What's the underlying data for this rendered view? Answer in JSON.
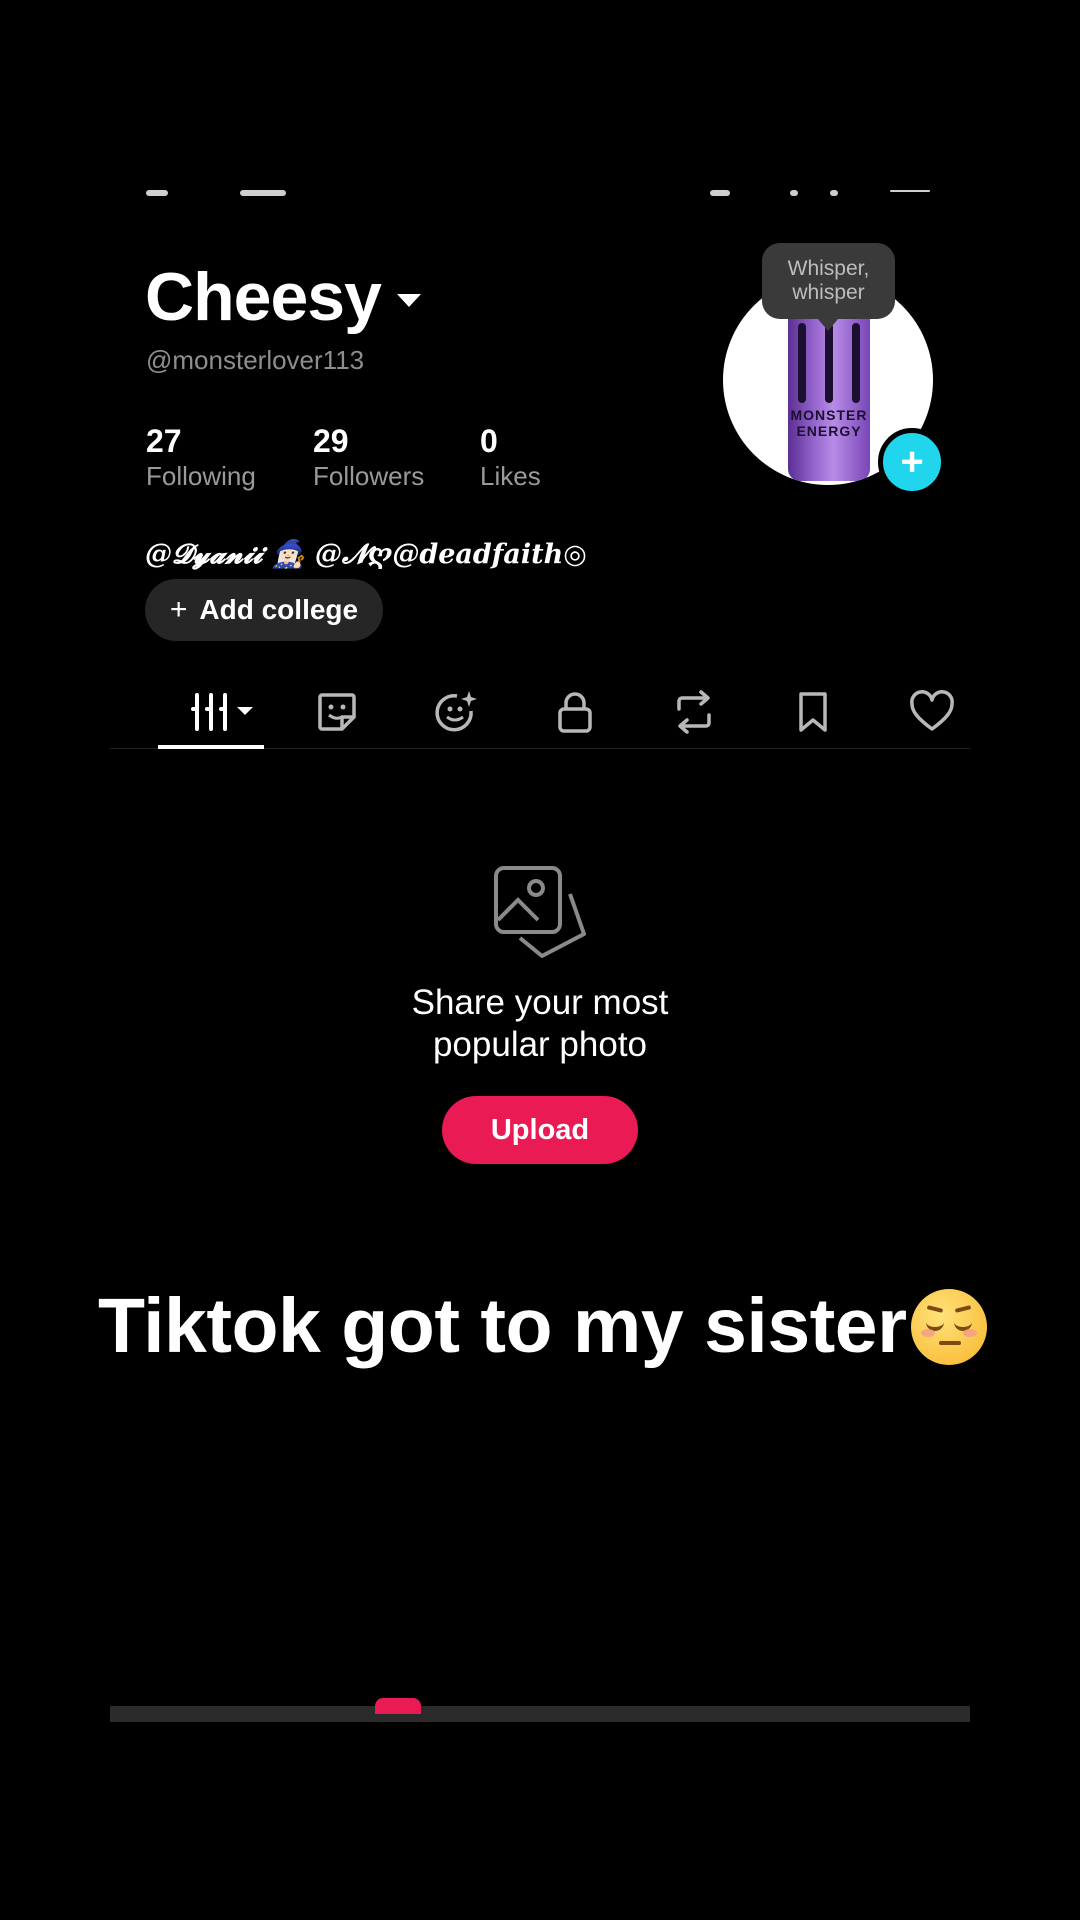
{
  "profile": {
    "display_name": "Cheesy",
    "username": "@monsterlover113",
    "bio": "@𝓓𝔂𝓪𝓷𝓲𝓲 🧙🏻‍♀️ @𝓝ღ@deadfaith◎",
    "add_college_label": "Add college",
    "whisper_line1": "Whisper,",
    "whisper_line2": "whisper",
    "avatar_can_text": "MONSTER ENERGY"
  },
  "stats": [
    {
      "value": "27",
      "label": "Following"
    },
    {
      "value": "29",
      "label": "Followers"
    },
    {
      "value": "0",
      "label": "Likes"
    }
  ],
  "tabs": [
    {
      "icon": "grid-icon",
      "active": true
    },
    {
      "icon": "sticker-icon"
    },
    {
      "icon": "sparkle-face-icon"
    },
    {
      "icon": "lock-icon"
    },
    {
      "icon": "repost-icon"
    },
    {
      "icon": "bookmark-icon"
    },
    {
      "icon": "heart-icon"
    }
  ],
  "empty_state": {
    "title_line1": "Share your most",
    "title_line2": "popular photo",
    "upload_label": "Upload"
  },
  "caption": "Tiktok got to my sister",
  "colors": {
    "background": "#000000",
    "upload_button": "#ea1a55",
    "avatar_add": "#20d5ec"
  }
}
